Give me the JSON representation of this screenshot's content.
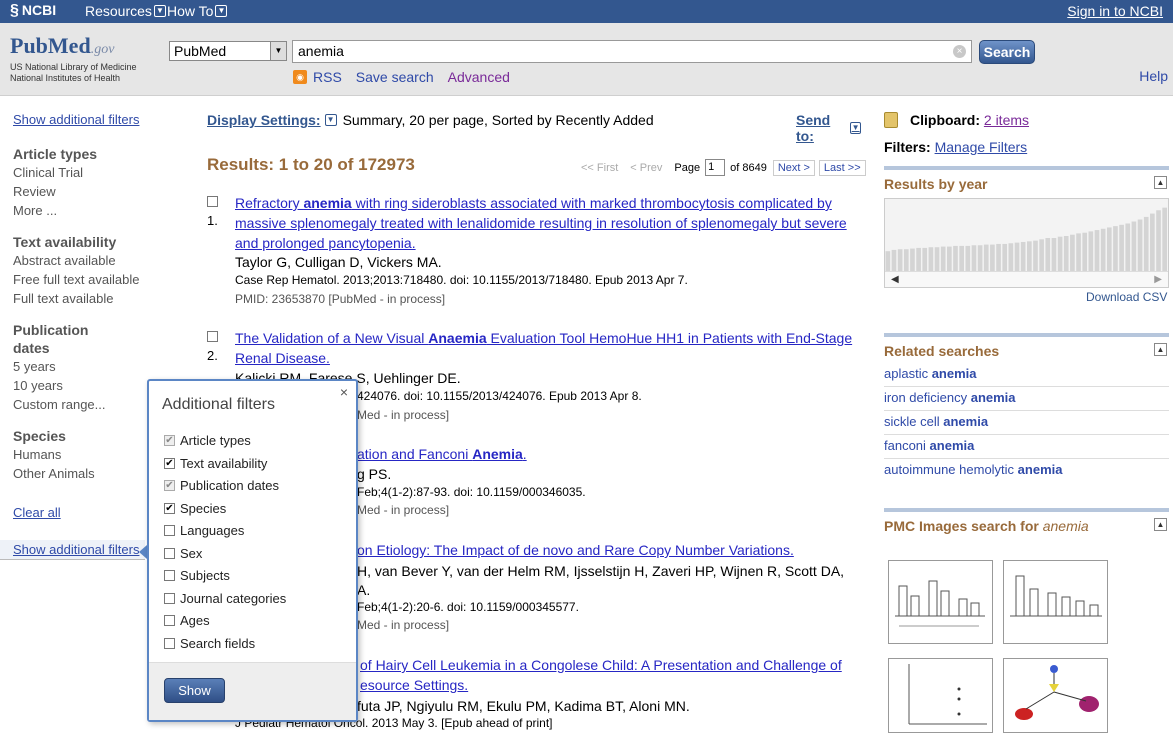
{
  "topbar": {
    "brand": "NCBI",
    "resources": "Resources",
    "howto": "How To",
    "signin": "Sign in to NCBI"
  },
  "header": {
    "logo_pub": "Pub",
    "logo_med": "Med",
    "logo_gov": ".gov",
    "nlm_line1": "US National Library of Medicine",
    "nlm_line2": "National Institutes of Health",
    "db_selected": "PubMed",
    "search_value": "anemia",
    "search_button": "Search",
    "rss": "RSS",
    "save_search": "Save search",
    "advanced": "Advanced",
    "help": "Help"
  },
  "sidebar": {
    "show_additional_top": "Show additional filters",
    "article_types": {
      "title": "Article types",
      "items": [
        "Clinical Trial",
        "Review",
        "More ..."
      ]
    },
    "text_availability": {
      "title": "Text availability",
      "items": [
        "Abstract available",
        "Free full text available",
        "Full text available"
      ]
    },
    "publication_dates": {
      "title_line1": "Publication",
      "title_line2": "dates",
      "items": [
        "5 years",
        "10 years",
        "Custom range..."
      ]
    },
    "species": {
      "title": "Species",
      "items": [
        "Humans",
        "Other Animals"
      ]
    },
    "clear_all": "Clear all",
    "show_additional_bottom": "Show additional filters"
  },
  "main": {
    "display_settings_label": "Display Settings:",
    "display_settings_value": "Summary, 20 per page, Sorted by Recently Added",
    "send_to": "Send to:",
    "results_count": "Results: 1 to 20 of 172973",
    "pager": {
      "first": "<< First",
      "prev": "< Prev",
      "page_label": "Page",
      "page_value": "1",
      "of_pages": "of 8649",
      "next": "Next >",
      "last": "Last >>"
    },
    "results": [
      {
        "num": "1.",
        "title_pre": "Refractory ",
        "title_hl": "anemia",
        "title_post": " with ring sideroblasts associated with marked thrombocytosis complicated by massive splenomegaly treated with lenalidomide resulting in resolution of splenomegaly but severe and prolonged pancytopenia.",
        "authors": "Taylor G, Culligan D, Vickers MA.",
        "cite": "Case Rep Hematol. 2013;2013:718480. doi: 10.1155/2013/718480. Epub 2013 Apr 7.",
        "pmid": "PMID: 23653870 [PubMed - in process]"
      },
      {
        "num": "2.",
        "title_pre": "The Validation of a New Visual ",
        "title_hl": "Anaemia",
        "title_post": " Evaluation Tool HemoHue HH1 in Patients with End-Stage Renal Disease.",
        "authors": "Kalicki RM, Farese S, Uehlinger DE.",
        "cite": "424076. doi: 10.1155/2013/424076. Epub 2013 Apr 8.",
        "pmid": "Med - in process]"
      },
      {
        "num": "3.",
        "title_pre": "ation and Fanconi ",
        "title_hl": "Anemia",
        "title_post": ".",
        "authors": "g PS.",
        "cite": "Feb;4(1-2):87-93. doi: 10.1159/000346035.",
        "pmid": "Med - in process]"
      },
      {
        "num": "4.",
        "title_pre": "on Etiology: The Impact of de novo and Rare Copy Number Variations.",
        "title_hl": "",
        "title_post": "",
        "authors": "H, van Bever Y, van der Helm RM, Ijsselstijn H, Zaveri HP, Wijnen R, Scott DA,",
        "authors2": "A.",
        "cite": "Feb;4(1-2):20-6. doi: 10.1159/000345577.",
        "pmid": "Med - in process]"
      },
      {
        "num": "5.",
        "title_line1": "of Hairy Cell Leukemia in a Congolese Child: A Presentation and Challenge of",
        "title_line2": "esource Settings.",
        "authors": "futa JP, Ngiyulu RM, Ekulu PM, Kadima BT, Aloni MN.",
        "cite": "J Pediatr Hematol Oncol. 2013 May 3. [Epub ahead of print]"
      }
    ]
  },
  "right": {
    "clipboard_label": "Clipboard:",
    "clipboard_items": "2 items",
    "filters_label": "Filters:",
    "manage_filters": "Manage Filters",
    "results_by_year": "Results by year",
    "download_csv": "Download CSV",
    "year_bar_levels": [
      0.3,
      0.32,
      0.33,
      0.33,
      0.34,
      0.35,
      0.35,
      0.36,
      0.36,
      0.37,
      0.37,
      0.38,
      0.38,
      0.38,
      0.39,
      0.39,
      0.4,
      0.4,
      0.41,
      0.41,
      0.42,
      0.43,
      0.44,
      0.45,
      0.46,
      0.48,
      0.5,
      0.5,
      0.52,
      0.53,
      0.55,
      0.57,
      0.58,
      0.6,
      0.62,
      0.64,
      0.66,
      0.68,
      0.7,
      0.72,
      0.75,
      0.78,
      0.82,
      0.87,
      0.92,
      0.96
    ],
    "related_searches": "Related searches",
    "related": [
      {
        "pre": "aplastic ",
        "hl": "anemia"
      },
      {
        "pre": "iron deficiency ",
        "hl": "anemia"
      },
      {
        "pre": "sickle cell ",
        "hl": "anemia"
      },
      {
        "pre": "fanconi ",
        "hl": "anemia"
      },
      {
        "pre": "autoimmune hemolytic ",
        "hl": "anemia"
      }
    ],
    "pmc_title": "PMC Images search for ",
    "pmc_term": "anemia"
  },
  "popup": {
    "title": "Additional filters",
    "close": "×",
    "options": [
      {
        "label": "Article types",
        "state": "grey"
      },
      {
        "label": "Text availability",
        "state": "on"
      },
      {
        "label": "Publication dates",
        "state": "grey"
      },
      {
        "label": "Species",
        "state": "on"
      },
      {
        "label": "Languages",
        "state": "off"
      },
      {
        "label": "Sex",
        "state": "off"
      },
      {
        "label": "Subjects",
        "state": "off"
      },
      {
        "label": "Journal categories",
        "state": "off"
      },
      {
        "label": "Ages",
        "state": "off"
      },
      {
        "label": "Search fields",
        "state": "off"
      }
    ],
    "show_button": "Show"
  },
  "colors": {
    "ncbi_blue": "#33578f",
    "result_title": "#2626c4",
    "results_brown": "#986a3a",
    "popup_border": "#5b86c5"
  }
}
